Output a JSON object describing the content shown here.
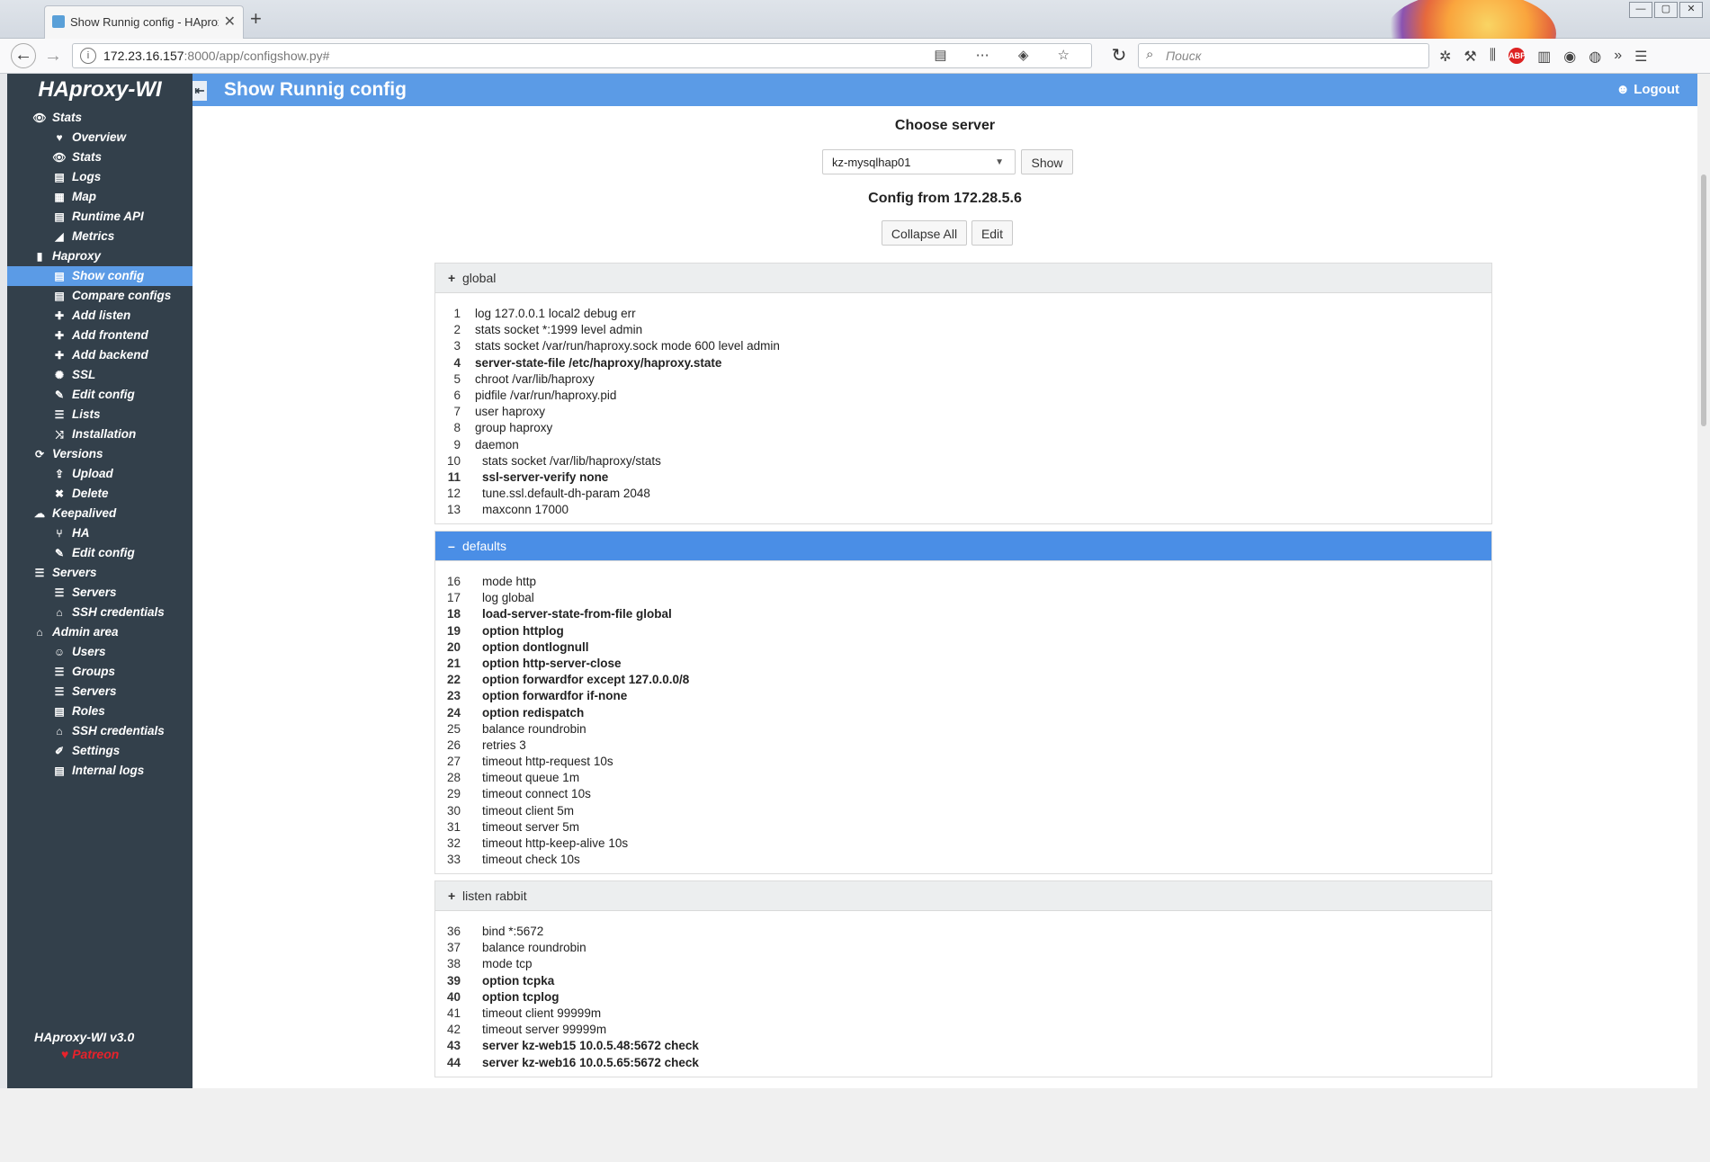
{
  "browser": {
    "tab_title": "Show Runnig config - HAproxy",
    "tab_close": "✕",
    "new_tab": "+",
    "url_host": "172.23.16.157",
    "url_rest": ":8000/app/configshow.py#",
    "search_placeholder": "Поиск",
    "url_icons": "▤ ⋯ ◈ ☆",
    "reload": "↻",
    "window_buttons": [
      "—",
      "▢",
      "✕"
    ]
  },
  "sidebar": {
    "brand": "HAproxy-WI",
    "items": [
      {
        "label": "Stats",
        "icon": "👁",
        "level": "top",
        "name": "stats"
      },
      {
        "label": "Overview",
        "icon": "♥",
        "level": "sub",
        "name": "overview"
      },
      {
        "label": "Stats",
        "icon": "👁",
        "level": "sub",
        "name": "stats-sub"
      },
      {
        "label": "Logs",
        "icon": "▤",
        "level": "sub",
        "name": "logs"
      },
      {
        "label": "Map",
        "icon": "▦",
        "level": "sub",
        "name": "map"
      },
      {
        "label": "Runtime API",
        "icon": "▤",
        "level": "sub",
        "name": "runtime-api"
      },
      {
        "label": "Metrics",
        "icon": "◢",
        "level": "sub",
        "name": "metrics"
      },
      {
        "label": "Haproxy",
        "icon": "▮",
        "level": "top",
        "name": "haproxy"
      },
      {
        "label": "Show config",
        "icon": "▤",
        "level": "sub",
        "name": "show-config",
        "active": true
      },
      {
        "label": "Compare configs",
        "icon": "▤",
        "level": "sub",
        "name": "compare-configs"
      },
      {
        "label": "Add listen",
        "icon": "✚",
        "level": "sub",
        "name": "add-listen"
      },
      {
        "label": "Add frontend",
        "icon": "✚",
        "level": "sub",
        "name": "add-frontend"
      },
      {
        "label": "Add backend",
        "icon": "✚",
        "level": "sub",
        "name": "add-backend"
      },
      {
        "label": "SSL",
        "icon": "✺",
        "level": "sub",
        "name": "ssl"
      },
      {
        "label": "Edit config",
        "icon": "✎",
        "level": "sub",
        "name": "edit-config"
      },
      {
        "label": "Lists",
        "icon": "☰",
        "level": "sub",
        "name": "lists"
      },
      {
        "label": "Installation",
        "icon": "⤨",
        "level": "sub",
        "name": "installation"
      },
      {
        "label": "Versions",
        "icon": "⟳",
        "level": "top",
        "name": "versions"
      },
      {
        "label": "Upload",
        "icon": "⇪",
        "level": "sub",
        "name": "upload"
      },
      {
        "label": "Delete",
        "icon": "✖",
        "level": "sub",
        "name": "delete"
      },
      {
        "label": "Keepalived",
        "icon": "☁",
        "level": "top",
        "name": "keepalived"
      },
      {
        "label": "HA",
        "icon": "⑂",
        "level": "sub",
        "name": "ha"
      },
      {
        "label": "Edit config",
        "icon": "✎",
        "level": "sub",
        "name": "keepalived-edit-config"
      },
      {
        "label": "Servers",
        "icon": "☰",
        "level": "top",
        "name": "servers"
      },
      {
        "label": "Servers",
        "icon": "☰",
        "level": "sub",
        "name": "servers-sub"
      },
      {
        "label": "SSH credentials",
        "icon": "⌂",
        "level": "sub",
        "name": "ssh-credentials"
      },
      {
        "label": "Admin area",
        "icon": "⌂",
        "level": "top",
        "name": "admin-area"
      },
      {
        "label": "Users",
        "icon": "☺",
        "level": "sub",
        "name": "users"
      },
      {
        "label": "Groups",
        "icon": "☰",
        "level": "sub",
        "name": "groups"
      },
      {
        "label": "Servers",
        "icon": "☰",
        "level": "sub",
        "name": "admin-servers"
      },
      {
        "label": "Roles",
        "icon": "▤",
        "level": "sub",
        "name": "roles"
      },
      {
        "label": "SSH credentials",
        "icon": "⌂",
        "level": "sub",
        "name": "admin-ssh-credentials"
      },
      {
        "label": "Settings",
        "icon": "✐",
        "level": "sub",
        "name": "settings"
      },
      {
        "label": "Internal logs",
        "icon": "▤",
        "level": "sub",
        "name": "internal-logs"
      }
    ],
    "version": "HAproxy-WI v3.0",
    "patreon": "♥ Patreon"
  },
  "header": {
    "collapse": "⇤",
    "title": "Show Runnig config",
    "logout": "Logout",
    "logout_icon": "☻"
  },
  "main": {
    "choose_label": "Choose server",
    "server_selected": "kz-mysqlhap01",
    "show_button": "Show",
    "config_from": "Config from 172.28.5.6",
    "collapse_all": "Collapse All",
    "edit": "Edit"
  },
  "sections": [
    {
      "name": "global",
      "sign": "+",
      "open": false,
      "lines": [
        {
          "n": "1",
          "t": "log 127.0.0.1 local2 debug err",
          "b": false,
          "i": 0
        },
        {
          "n": "2",
          "t": "stats socket *:1999 level admin",
          "b": false,
          "i": 0
        },
        {
          "n": "3",
          "t": "stats socket /var/run/haproxy.sock mode 600 level admin",
          "b": false,
          "i": 0
        },
        {
          "n": "4",
          "t": "server-state-file /etc/haproxy/haproxy.state",
          "b": true,
          "i": 0
        },
        {
          "n": "5",
          "t": "chroot /var/lib/haproxy",
          "b": false,
          "i": 0
        },
        {
          "n": "6",
          "t": "pidfile /var/run/haproxy.pid",
          "b": false,
          "i": 0
        },
        {
          "n": "7",
          "t": "user haproxy",
          "b": false,
          "i": 0
        },
        {
          "n": "8",
          "t": "group haproxy",
          "b": false,
          "i": 0
        },
        {
          "n": "9",
          "t": "daemon",
          "b": false,
          "i": 0
        },
        {
          "n": "10",
          "t": "stats socket /var/lib/haproxy/stats",
          "b": false,
          "i": 1
        },
        {
          "n": "11",
          "t": "ssl-server-verify none",
          "b": true,
          "i": 1
        },
        {
          "n": "12",
          "t": "tune.ssl.default-dh-param 2048",
          "b": false,
          "i": 1
        },
        {
          "n": "13",
          "t": "maxconn 17000",
          "b": false,
          "i": 1
        }
      ]
    },
    {
      "name": "defaults",
      "sign": "–",
      "open": true,
      "lines": [
        {
          "n": "16",
          "t": "mode http",
          "b": false,
          "i": 1
        },
        {
          "n": "17",
          "t": "log global",
          "b": false,
          "i": 1
        },
        {
          "n": "18",
          "t": "load-server-state-from-file global",
          "b": true,
          "i": 1
        },
        {
          "n": "19",
          "t": "option httplog",
          "b": true,
          "i": 1
        },
        {
          "n": "20",
          "t": "option dontlognull",
          "b": true,
          "i": 1
        },
        {
          "n": "21",
          "t": "option http-server-close",
          "b": true,
          "i": 1
        },
        {
          "n": "22",
          "t": "option forwardfor except 127.0.0.0/8",
          "b": true,
          "i": 1
        },
        {
          "n": "23",
          "t": "option forwardfor if-none",
          "b": true,
          "i": 1
        },
        {
          "n": "24",
          "t": "option redispatch",
          "b": true,
          "i": 1
        },
        {
          "n": "25",
          "t": "balance roundrobin",
          "b": false,
          "i": 1
        },
        {
          "n": "26",
          "t": "retries 3",
          "b": false,
          "i": 1
        },
        {
          "n": "27",
          "t": "timeout http-request 10s",
          "b": false,
          "i": 1
        },
        {
          "n": "28",
          "t": "timeout queue 1m",
          "b": false,
          "i": 1
        },
        {
          "n": "29",
          "t": "timeout connect 10s",
          "b": false,
          "i": 1
        },
        {
          "n": "30",
          "t": "timeout client 5m",
          "b": false,
          "i": 1
        },
        {
          "n": "31",
          "t": "timeout server 5m",
          "b": false,
          "i": 1
        },
        {
          "n": "32",
          "t": "timeout http-keep-alive 10s",
          "b": false,
          "i": 1
        },
        {
          "n": "33",
          "t": "timeout check 10s",
          "b": false,
          "i": 1
        }
      ]
    },
    {
      "name": "listen rabbit",
      "sign": "+",
      "open": false,
      "lines": [
        {
          "n": "36",
          "t": "bind *:5672",
          "b": false,
          "i": 1
        },
        {
          "n": "37",
          "t": "balance roundrobin",
          "b": false,
          "i": 1
        },
        {
          "n": "38",
          "t": "mode tcp",
          "b": false,
          "i": 1
        },
        {
          "n": "39",
          "t": "option tcpka",
          "b": true,
          "i": 1
        },
        {
          "n": "40",
          "t": "option tcplog",
          "b": true,
          "i": 1
        },
        {
          "n": "41",
          "t": "timeout client 99999m",
          "b": false,
          "i": 1
        },
        {
          "n": "42",
          "t": "timeout server 99999m",
          "b": false,
          "i": 1
        },
        {
          "n": "43",
          "t": "server kz-web15 10.0.5.48:5672 check",
          "b": true,
          "i": 1
        },
        {
          "n": "44",
          "t": "server kz-web16 10.0.5.65:5672 check",
          "b": true,
          "i": 1
        }
      ]
    }
  ]
}
